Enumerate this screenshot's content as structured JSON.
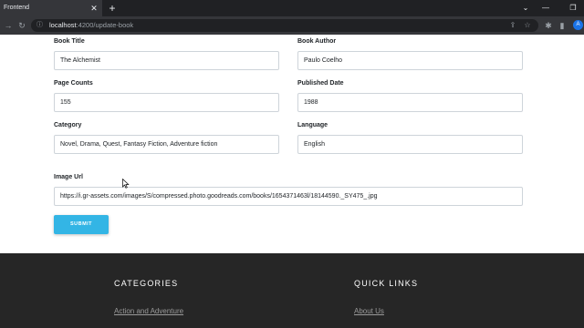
{
  "browser": {
    "tab_title": "Frontend",
    "tab_close": "✕",
    "new_tab": "+",
    "url_host": "localhost",
    "url_path": ":4200/update-book",
    "avatar_letter": "A"
  },
  "form": {
    "fields": [
      {
        "label": "Book Title",
        "value": "The Alchemist"
      },
      {
        "label": "Book Author",
        "value": "Paulo Coelho"
      },
      {
        "label": "Page Counts",
        "value": "155"
      },
      {
        "label": "Published Date",
        "value": "1988"
      },
      {
        "label": "Category",
        "value": "Novel, Drama, Quest, Fantasy Fiction, Adventure fiction"
      },
      {
        "label": "Language",
        "value": "English"
      },
      {
        "label": "Image Url",
        "value": "https://i.gr-assets.com/images/S/compressed.photo.goodreads.com/books/1654371463l/18144590._SY475_.jpg"
      }
    ],
    "submit_label": "SUBMIT"
  },
  "footer": {
    "categories_heading": "CATEGORIES",
    "quick_links_heading": "QUICK LINKS",
    "categories_link": "Action and Adventure",
    "quick_link": "About Us"
  }
}
